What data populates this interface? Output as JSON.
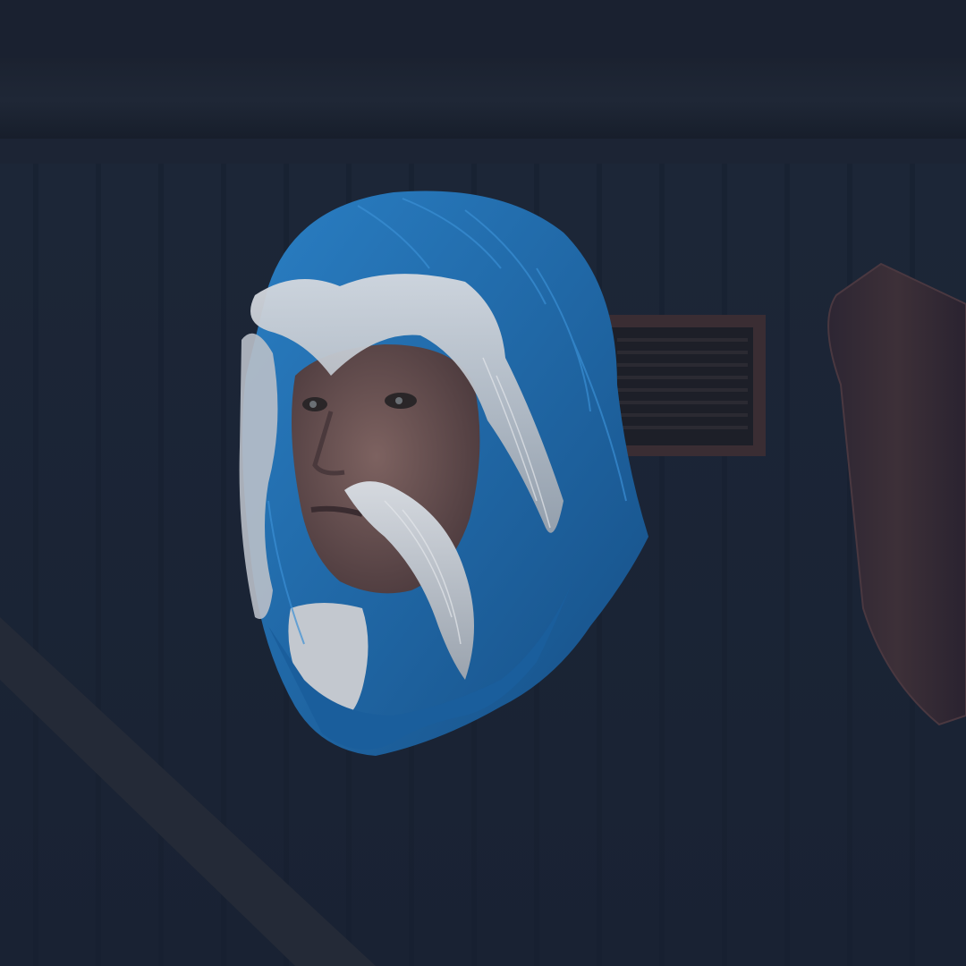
{
  "scene": {
    "subject": "floating-character-head",
    "colors": {
      "background": "#1c2536",
      "background_dark": "#141a26",
      "wall_panel": "#1e2a3d",
      "wall_panel_line": "#172030",
      "beam": "#1a2231",
      "vent_frame": "#3a2e34",
      "vent_slats": "#1c1e27",
      "hair_blue": "#1f6fb3",
      "hair_blue_dark": "#154f84",
      "hair_white": "#c9cdd4",
      "skin": "#6e5654",
      "skin_shadow": "#4b3a3d",
      "brown_object": "#3a2f36",
      "diagonal_beam": "#232836"
    }
  }
}
